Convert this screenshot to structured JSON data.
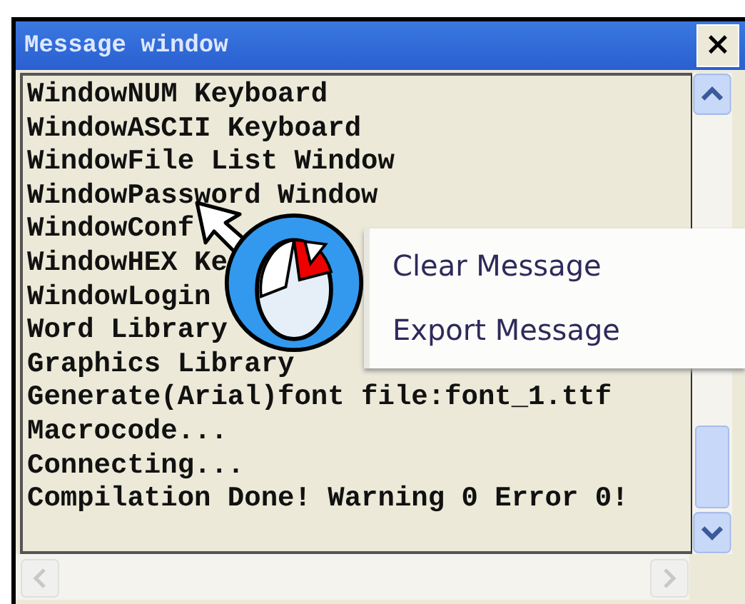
{
  "window": {
    "title": "Message window",
    "close": "×"
  },
  "messages": [
    "WindowNUM Keyboard",
    "WindowASCII Keyboard",
    "WindowFile List Window",
    "WindowPassword Window",
    "WindowConf",
    "WindowHEX Ke",
    "WindowLogin",
    "Word Library",
    "Graphics Library",
    "Generate(Arial)font file:font_1.ttf",
    "Macrocode...",
    "Connecting...",
    "Compilation Done! Warning 0 Error 0!"
  ],
  "context_menu": {
    "items": [
      "Clear Message",
      "Export Message"
    ]
  }
}
